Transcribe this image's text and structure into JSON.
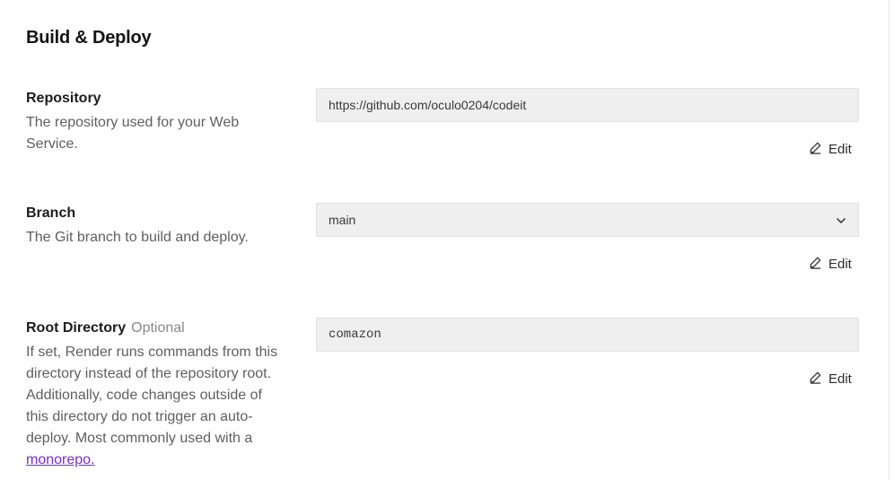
{
  "section": {
    "title": "Build & Deploy"
  },
  "repository": {
    "label": "Repository",
    "description": "The repository used for your Web Service.",
    "value": "https://github.com/oculo0204/codeit",
    "edit_label": "Edit"
  },
  "branch": {
    "label": "Branch",
    "description": "The Git branch to build and deploy.",
    "value": "main",
    "edit_label": "Edit"
  },
  "root_directory": {
    "label": "Root Directory",
    "optional_tag": "Optional",
    "description": "If set, Render runs commands from this directory instead of the repository root. Additionally, code changes outside of this directory do not trigger an auto-deploy. Most commonly used with a",
    "link_text": "monorepo.",
    "value": "comazon",
    "edit_label": "Edit"
  },
  "icons": {
    "edit": "pencil-icon",
    "dropdown": "chevron-down-icon"
  },
  "colors": {
    "field_bg": "#efefef",
    "link": "#7b2bd6",
    "muted": "#5f5f5f"
  }
}
